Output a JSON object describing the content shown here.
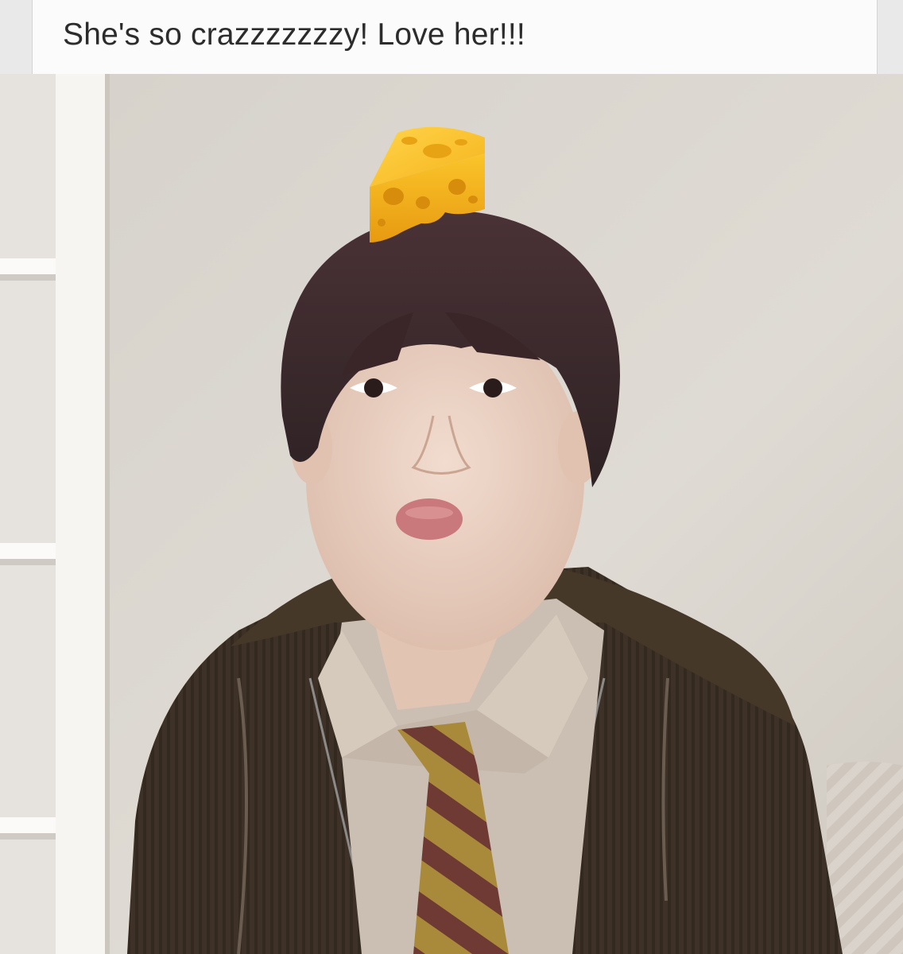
{
  "caption": {
    "text": "She's so crazzzzzzzy! Love her!!!"
  },
  "photo": {
    "subject": "person-portrait",
    "sticker": "cheese-icon",
    "colors": {
      "wall": "#dcd7cf",
      "shelf": "#eeece8",
      "hair": "#3a2a2c",
      "skin": "#ead0c0",
      "hoodie": "#3d3128",
      "shirt": "#c9bcb0",
      "tie_gold": "#a98a3a",
      "tie_maroon": "#6e3a33",
      "cheese": "#f6b81f"
    }
  }
}
